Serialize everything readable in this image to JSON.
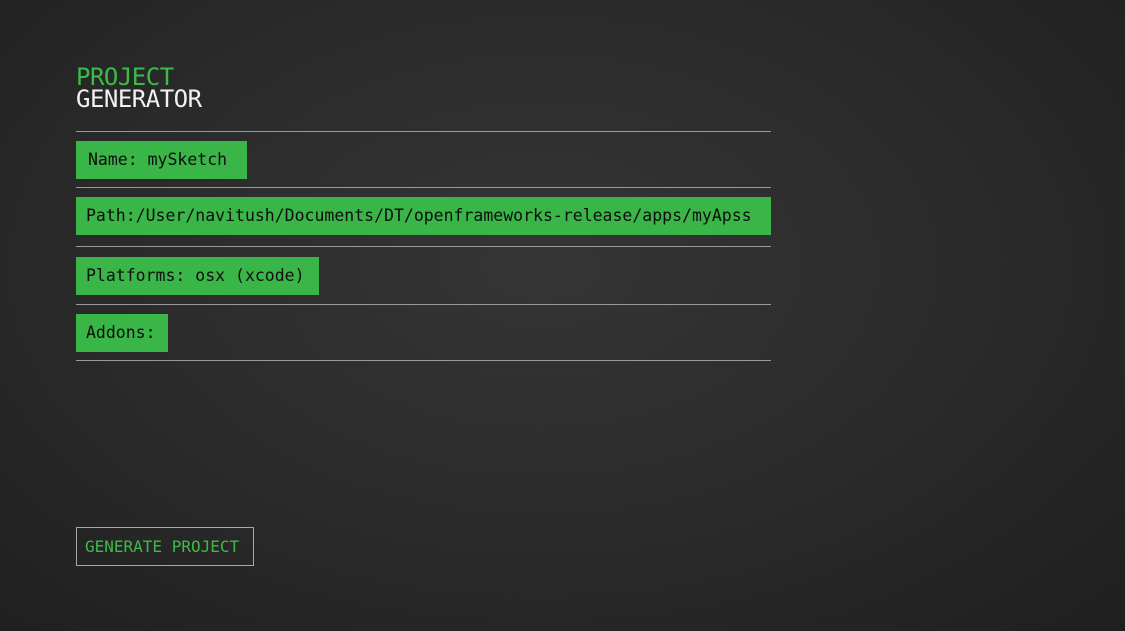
{
  "header": {
    "title_line1": "PROJECT",
    "title_line2": "GENERATOR"
  },
  "fields": {
    "name": "Name: mySketch",
    "path": "Path:/User/navitush/Documents/DT/openframeworks-release/apps/myApss",
    "platforms": "Platforms: osx (xcode)",
    "addons": "Addons:"
  },
  "actions": {
    "generate_label": "GENERATE PROJECT"
  },
  "colors": {
    "accent": "#3ab547",
    "background": "#2c2c2c",
    "title_text": "#f2f2f2",
    "field_text": "#0e0e0e"
  }
}
